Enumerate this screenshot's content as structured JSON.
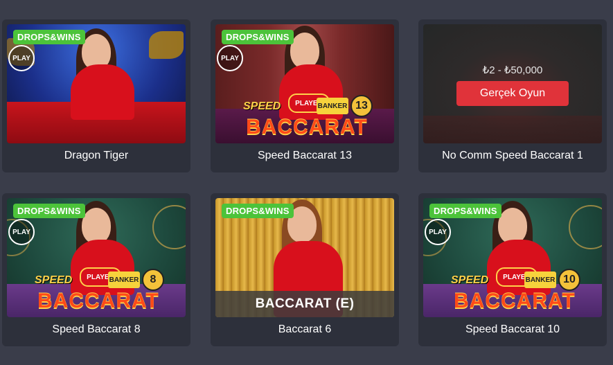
{
  "cards": [
    {
      "title": "Dragon Tiger",
      "badge": "DROPS&WINS",
      "play": "PLAY"
    },
    {
      "title": "Speed Baccarat 13",
      "badge": "DROPS&WINS",
      "play": "PLAY",
      "speed": "SPEED",
      "logo": "BACCARAT",
      "player": "PLAYER",
      "banker": "BANKER",
      "number": "13"
    },
    {
      "title": "No Comm Speed Baccarat 1",
      "range": "₺2 - ₺50,000",
      "button": "Gerçek Oyun"
    },
    {
      "title": "Speed Baccarat 8",
      "badge": "DROPS&WINS",
      "play": "PLAY",
      "speed": "SPEED",
      "logo": "BACCARAT",
      "player": "PLAYER",
      "banker": "BANKER",
      "number": "8"
    },
    {
      "title": "Baccarat 6",
      "badge": "DROPS&WINS",
      "caption": "BACCARAT (E)"
    },
    {
      "title": "Speed Baccarat 10",
      "badge": "DROPS&WINS",
      "play": "PLAY",
      "speed": "SPEED",
      "logo": "BACCARAT",
      "player": "PLAYER",
      "banker": "BANKER",
      "number": "10"
    }
  ],
  "colors": {
    "page_bg": "#3a3d4a",
    "card_bg": "#2d303b",
    "badge": "#4cc33a",
    "button": "#e0333a"
  }
}
